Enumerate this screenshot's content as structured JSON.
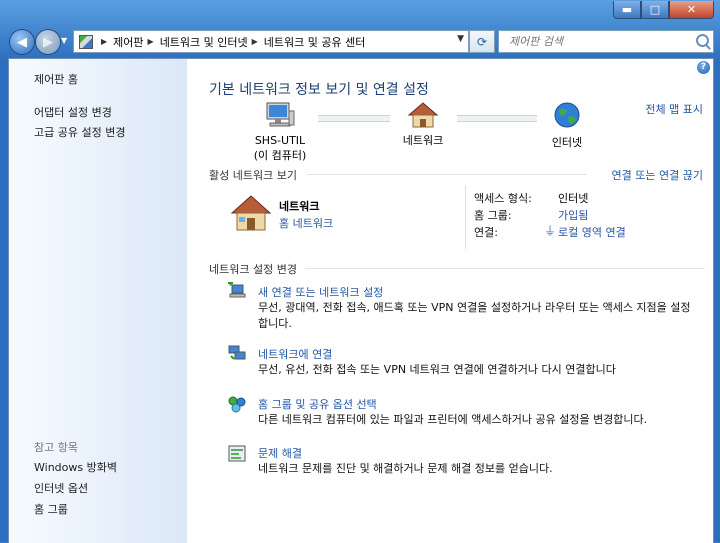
{
  "window": {
    "caption_buttons": {
      "minimize": "▬",
      "maximize": "□",
      "close": "✕"
    }
  },
  "nav": {
    "back_icon": "◀",
    "forward_icon": "▶",
    "dropdown_icon": "▼",
    "breadcrumbs": [
      "제어판",
      "네트워크 및 인터넷",
      "네트워크 및 공유 센터"
    ],
    "refresh_icon": "⟳",
    "search_placeholder": "제어판 검색"
  },
  "sidebar": {
    "links": [
      "제어판 홈",
      "어댑터 설정 변경",
      "고급 공유 설정 변경"
    ],
    "see_also_heading": "참고 항목",
    "see_also": [
      "Windows 방화벽",
      "인터넷 옵션",
      "홈 그룹"
    ]
  },
  "main": {
    "help_icon": "?",
    "title": "기본 네트워크 정보 보기 및 연결 설정",
    "full_map_link": "전체 맵 표시",
    "map": {
      "computer_name": "SHS-UTIL",
      "computer_sub": "(이 컴퓨터)",
      "network_label": "네트워크",
      "internet_label": "인터넷"
    },
    "active": {
      "heading": "활성 네트워크 보기",
      "disconnect_link": "연결 또는 연결 끊기",
      "network_name": "네트워크",
      "network_type": "홈 네트워크",
      "access_type_label": "액세스 형식:",
      "access_type_value": "인터넷",
      "homegroup_label": "홈 그룹:",
      "homegroup_value": "가입됨",
      "connection_label": "연결:",
      "connection_value": "로컬 영역 연결"
    },
    "settings": {
      "heading": "네트워크 설정 변경",
      "tasks": [
        {
          "title": "새 연결 또는 네트워크 설정",
          "desc": "무선, 광대역, 전화 접속, 애드혹 또는 VPN 연결을 설정하거나 라우터 또는 액세스 지점을 설정합니다."
        },
        {
          "title": "네트워크에 연결",
          "desc": "무선, 유선, 전화 접속 또는 VPN 네트워크 연결에 연결하거나 다시 연결합니다"
        },
        {
          "title": "홈 그룹 및 공유 옵션 선택",
          "desc": "다른 네트워크 컴퓨터에 있는 파일과 프린터에 액세스하거나 공유 설정을 변경합니다."
        },
        {
          "title": "문제 해결",
          "desc": "네트워크 문제를 진단 및 해결하거나 문제 해결 정보를 얻습니다."
        }
      ]
    }
  }
}
